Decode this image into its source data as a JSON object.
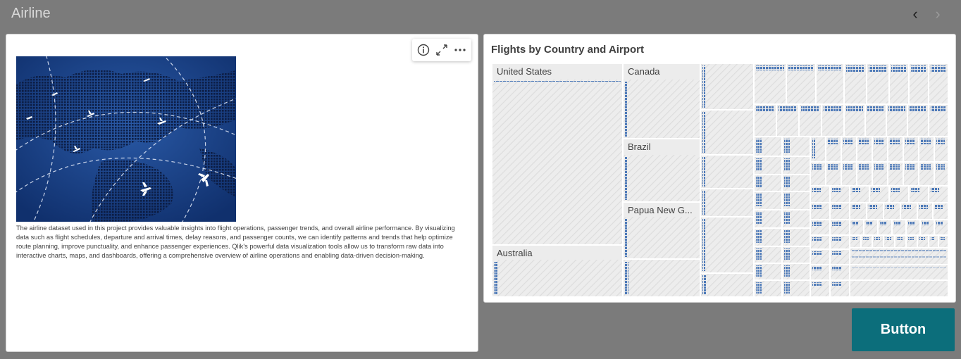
{
  "app": {
    "title": "Airline",
    "nav": {
      "prev_icon": "chevron-left-icon",
      "next_icon": "chevron-right-icon"
    }
  },
  "text_card": {
    "toolbar": {
      "info_icon": "info-icon",
      "expand_icon": "expand-icon",
      "more_icon": "more-icon"
    },
    "image": {
      "subject": "world-map-with-airplanes-and-flight-paths"
    },
    "description": "The airline dataset used in this project provides valuable insights into flight operations, passenger trends, and overall airline performance. By visualizing data such as flight schedules, departure and arrival times, delay reasons, and passenger counts, we can identify patterns and trends that help optimize route planning, improve punctuality, and enhance passenger experiences. Qlik's powerful data visualization tools allow us to transform raw data into interactive charts, maps, and dashboards, offering a comprehensive overview of airline operations and enabling data-driven decision-making."
  },
  "chart": {
    "title": "Flights by Country and Airport"
  },
  "chart_data": {
    "type": "treemap",
    "title": "Flights by Country and Airport",
    "labeled_groups": [
      "United States",
      "Canada",
      "Brazil",
      "Papua New G...",
      "Australia"
    ],
    "unlabeled_groups_shown": true
  },
  "button": {
    "label": "Button"
  },
  "colors": {
    "background": "#7b7b7b",
    "card": "#ffffff",
    "accent": "#0c6e7b",
    "treemap_mark": "#4e7ab8",
    "treemap_fill": "#ececec"
  }
}
